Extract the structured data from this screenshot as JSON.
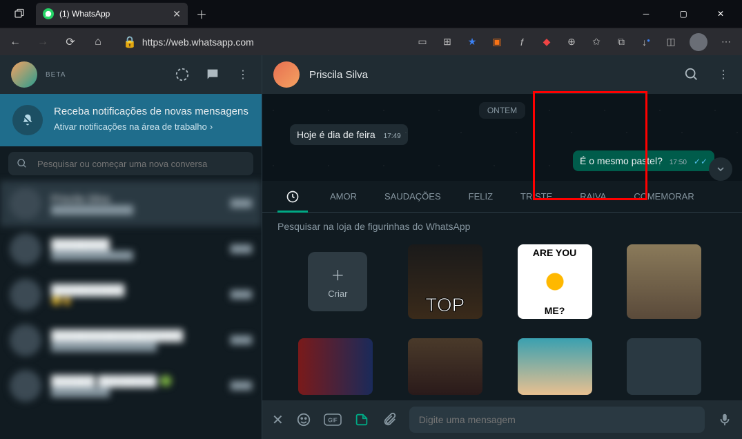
{
  "browser": {
    "tab_title": "(1) WhatsApp",
    "url": "https://web.whatsapp.com"
  },
  "sidebar": {
    "beta_label": "BETA",
    "notification": {
      "title": "Receba notificações de novas mensagens",
      "action": "Ativar notificações na área de trabalho"
    },
    "search_placeholder": "Pesquisar ou começar uma nova conversa"
  },
  "chat": {
    "contact_name": "Priscila Silva",
    "date_label": "ONTEM",
    "incoming": {
      "text": "Hoje é dia de feira",
      "time": "17:49"
    },
    "outgoing": {
      "text": "É o mesmo pastel?",
      "time": "17:50"
    }
  },
  "stickers": {
    "tabs": [
      "AMOR",
      "SAUDAÇÕES",
      "FELIZ",
      "TRISTE",
      "RAIVA",
      "COMEMORAR"
    ],
    "search_placeholder": "Pesquisar na loja de figurinhas do WhatsApp",
    "create_label": "Criar",
    "cells": {
      "top_text": "TOP",
      "areyou_top": "ARE YOU",
      "areyou_bottom": "ME?"
    }
  },
  "compose": {
    "placeholder": "Digite uma mensagem"
  }
}
